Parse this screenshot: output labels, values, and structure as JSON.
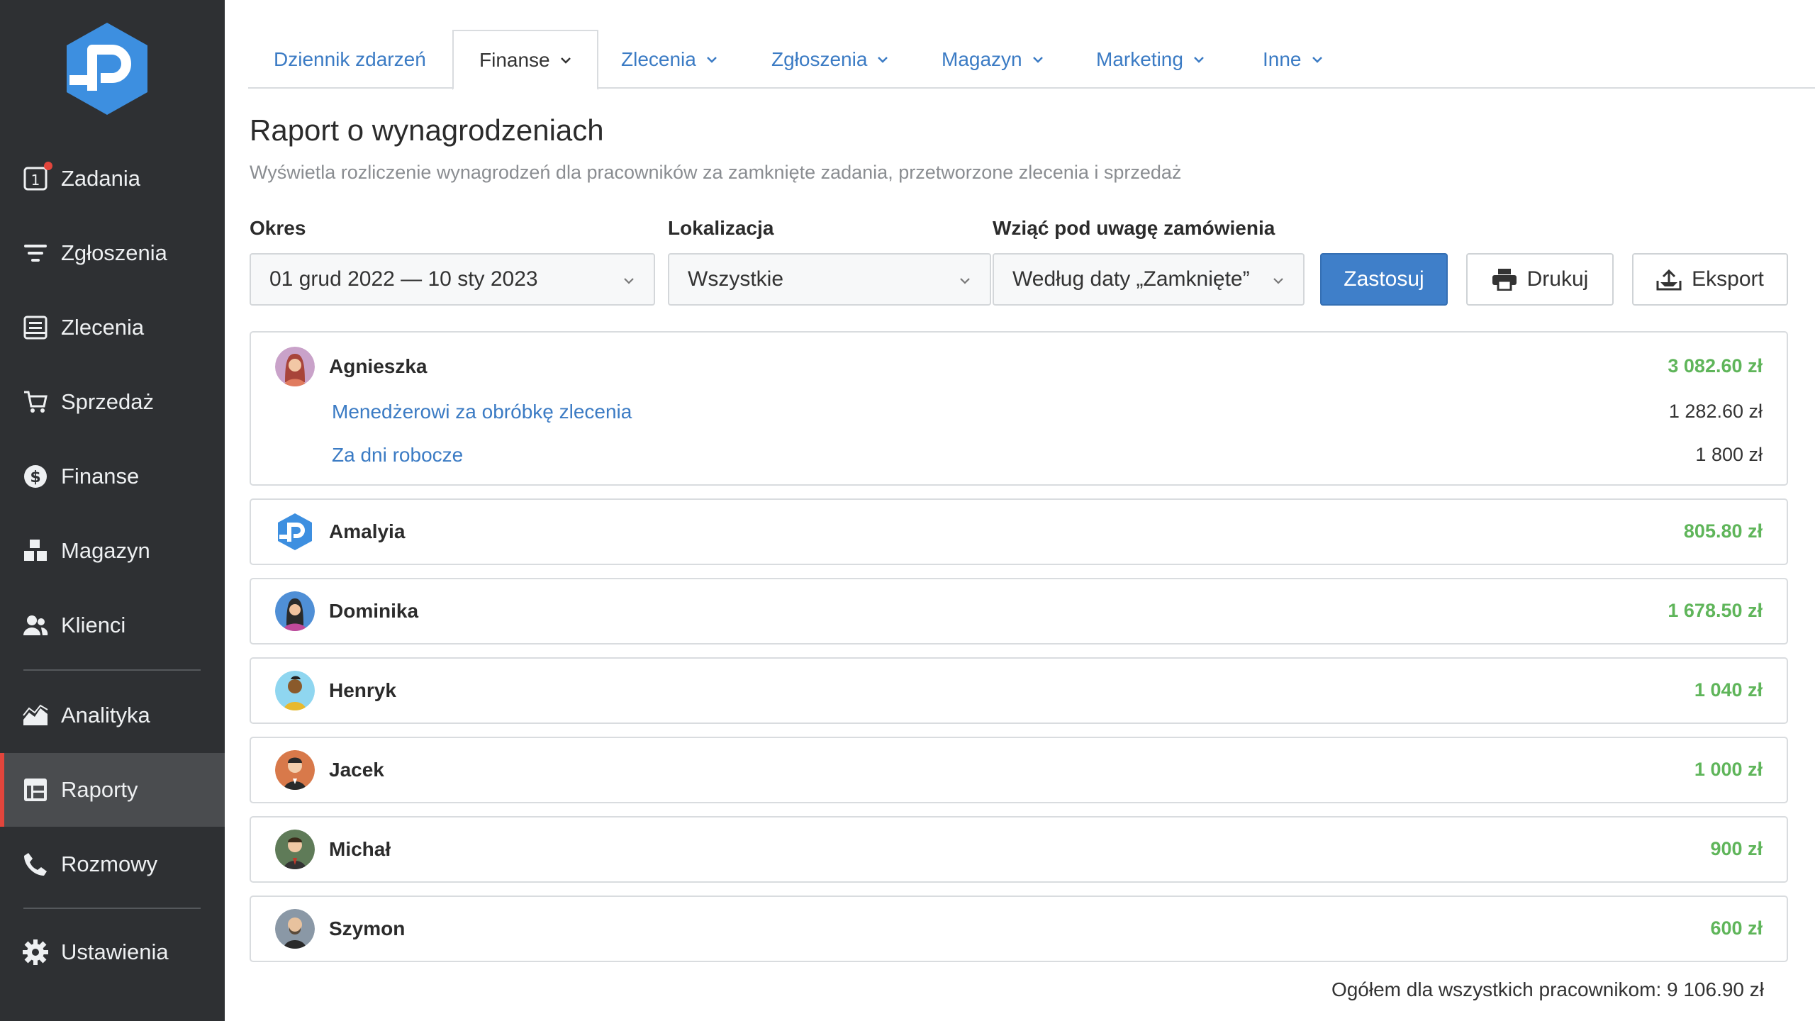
{
  "sidebar": {
    "items": [
      {
        "label": "Zadania",
        "icon": "tasks-icon",
        "badge": "1"
      },
      {
        "label": "Zgłoszenia",
        "icon": "filter-icon"
      },
      {
        "label": "Zlecenia",
        "icon": "orders-icon"
      },
      {
        "label": "Sprzedaż",
        "icon": "cart-icon"
      },
      {
        "label": "Finanse",
        "icon": "dollar-icon"
      },
      {
        "label": "Magazyn",
        "icon": "boxes-icon"
      },
      {
        "label": "Klienci",
        "icon": "users-icon"
      },
      {
        "label": "Analityka",
        "icon": "chart-icon"
      },
      {
        "label": "Raporty",
        "icon": "reports-icon",
        "active": true
      },
      {
        "label": "Rozmowy",
        "icon": "phone-icon"
      },
      {
        "label": "Ustawienia",
        "icon": "gear-icon"
      }
    ]
  },
  "tabs": [
    {
      "label": "Dziennik zdarzeń"
    },
    {
      "label": "Finanse",
      "active": true
    },
    {
      "label": "Zlecenia"
    },
    {
      "label": "Zgłoszenia"
    },
    {
      "label": "Magazyn"
    },
    {
      "label": "Marketing"
    },
    {
      "label": "Inne"
    }
  ],
  "page": {
    "title": "Raport o wynagrodzeniach",
    "subtitle": "Wyświetla rozliczenie wynagrodzeń dla pracowników za zamknięte zadania, przetworzone zlecenia i sprzedaż"
  },
  "filters": {
    "period_label": "Okres",
    "period_value": "01 grud 2022 — 10 sty 2023",
    "location_label": "Lokalizacja",
    "location_value": "Wszystkie",
    "orders_label": "Wziąć pod uwagę zamówienia",
    "orders_value": "Według daty „Zamknięte”"
  },
  "actions": {
    "apply": "Zastosuj",
    "print": "Drukuj",
    "export": "Eksport"
  },
  "employees": [
    {
      "name": "Agnieszka",
      "amount": "3 082.60 zł",
      "details": [
        {
          "label": "Menedżerowi za obróbkę zlecenia",
          "amount": "1 282.60 zł"
        },
        {
          "label": "Za dni robocze",
          "amount": "1 800 zł"
        }
      ]
    },
    {
      "name": "Amalyia",
      "amount": "805.80 zł"
    },
    {
      "name": "Dominika",
      "amount": "1 678.50 zł"
    },
    {
      "name": "Henryk",
      "amount": "1 040 zł"
    },
    {
      "name": "Jacek",
      "amount": "1 000 zł"
    },
    {
      "name": "Michał",
      "amount": "900 zł"
    },
    {
      "name": "Szymon",
      "amount": "600 zł"
    }
  ],
  "total": "Ogółem dla wszystkich pracownikom: 9 106.90 zł",
  "colors": {
    "sidebar_bg": "#2e3033",
    "accent_blue": "#3f7fc9",
    "amount_green": "#5fb55a",
    "active_marker": "#e2453c"
  }
}
